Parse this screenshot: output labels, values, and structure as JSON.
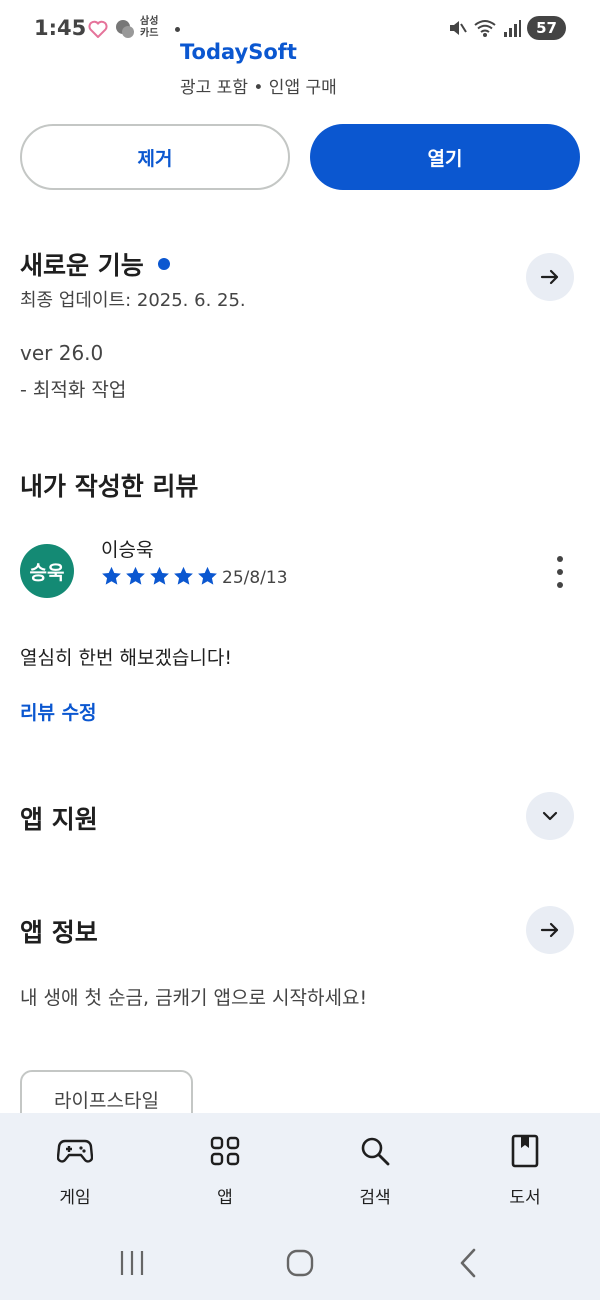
{
  "status_bar": {
    "time": "1:45",
    "card_line1": "삼성",
    "card_line2": "카드",
    "battery": "57"
  },
  "app": {
    "name": "TodaySoft",
    "meta": "광고 포함 • 인앱 구매"
  },
  "actions": {
    "remove_label": "제거",
    "open_label": "열기"
  },
  "whats_new": {
    "title": "새로운 기능",
    "updated": "최종 업데이트: 2025. 6. 25.",
    "version": "ver 26.0",
    "notes": "- 최적화 작업"
  },
  "my_review": {
    "title": "내가 작성한 리뷰",
    "avatar_text": "승욱",
    "reviewer": "이승욱",
    "rating": 5,
    "date": "25/8/13",
    "body": "열심히 한번 해보겠습니다!",
    "edit_label": "리뷰 수정"
  },
  "app_support": {
    "title": "앱 지원"
  },
  "app_info": {
    "title": "앱 정보",
    "description": "내 생애 첫 순금, 금캐기 앱으로 시작하세요!",
    "category_chip": "라이프스타일"
  },
  "bottom_nav": {
    "games": "게임",
    "apps": "앱",
    "search": "검색",
    "books": "도서"
  },
  "colors": {
    "accent": "#0b57d0",
    "avatar": "#148a74",
    "nav_bg": "#edf1f7"
  }
}
